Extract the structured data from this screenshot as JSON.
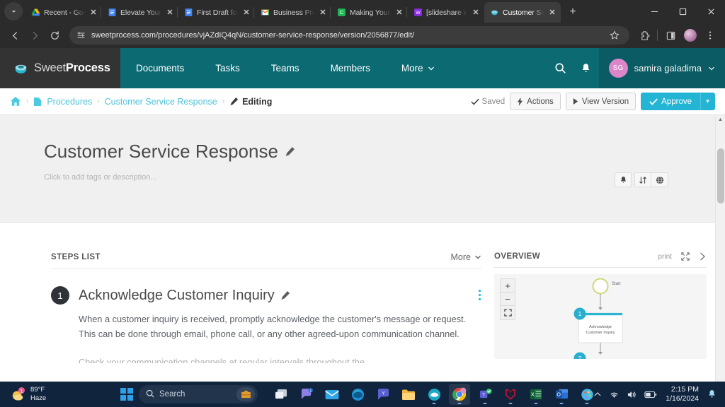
{
  "browser": {
    "tabs": [
      {
        "title": "Recent - Goo",
        "favicon": "google-drive-icon",
        "active": false
      },
      {
        "title": "Elevate Your H",
        "favicon": "google-docs-icon",
        "active": false
      },
      {
        "title": "First Draft for",
        "favicon": "google-docs-icon",
        "active": false
      },
      {
        "title": "Business Proc",
        "favicon": "gmail-icon",
        "active": false
      },
      {
        "title": "Making Your B",
        "favicon": "camtasia-icon",
        "active": false
      },
      {
        "title": "[slideshare id",
        "favicon": "wordpress-icon",
        "active": false
      },
      {
        "title": "Customer Ser",
        "favicon": "sweetprocess-icon",
        "active": true
      }
    ],
    "new_tab_label": "+",
    "window_minimize": "–",
    "window_maximize": "☐",
    "window_close": "✕",
    "url": "sweetprocess.com/procedures/vjAZdIQ4qN/customer-service-response/version/2056877/edit/",
    "back_label": "←",
    "forward_label": "→",
    "reload_label": "↻"
  },
  "topnav": {
    "logo_light": "Sweet",
    "logo_bold": "Process",
    "items": [
      {
        "label": "Documents",
        "has_caret": false
      },
      {
        "label": "Tasks",
        "has_caret": false
      },
      {
        "label": "Teams",
        "has_caret": false
      },
      {
        "label": "Members",
        "has_caret": false
      },
      {
        "label": "More",
        "has_caret": true
      }
    ],
    "user": {
      "initials": "SG",
      "name": "samira galadima"
    }
  },
  "breadcrumb": {
    "home": "home-icon",
    "items": [
      {
        "label": "Procedures",
        "type": "link"
      },
      {
        "label": "Customer Service Response",
        "type": "link"
      },
      {
        "label": "Editing",
        "type": "current"
      }
    ],
    "separator": "›"
  },
  "actions": {
    "saved_label": "Saved",
    "actions_label": "Actions",
    "view_version_label": "View Version",
    "approve_label": "Approve",
    "approve_caret": "▾"
  },
  "document": {
    "title": "Customer Service Response",
    "title_edit_icon": "pencil-icon",
    "subtitle_placeholder": "Click to add tags or description...",
    "head_icons": [
      "bell-icon",
      "sort-icon",
      "globe-icon"
    ]
  },
  "steps_panel": {
    "heading": "STEPS LIST",
    "more_label": "More",
    "more_caret": "▾",
    "steps": [
      {
        "number": "1",
        "title": "Acknowledge Customer Inquiry",
        "edit_icon": "pencil-icon",
        "menu_icon": "kebab-menu-icon",
        "body": "When a customer inquiry is received, promptly acknowledge the customer's message or request. This can be done through email, phone call, or any other agreed-upon communication channel.",
        "body_cut": "Check your communication channels at regular intervals throughout the"
      }
    ]
  },
  "overview_panel": {
    "heading": "OVERVIEW",
    "print_label": "print",
    "expand_icon": "expand-icon",
    "collapse_icon": "chevron-right-icon",
    "zoom_in": "+",
    "zoom_out": "−",
    "zoom_fit": "fit-screen-icon",
    "flowchart": {
      "start_label": "Start",
      "nodes": [
        {
          "number": "1",
          "label_line1": "Acknowledge",
          "label_line2": "Customer Inquiry"
        },
        {
          "number": "2",
          "label_line1": "",
          "label_line2": ""
        }
      ]
    }
  },
  "taskbar": {
    "weather": {
      "temp": "89°F",
      "condition": "Haze",
      "badge": "1"
    },
    "start_label": "windows-start-icon",
    "search_placeholder": "Search",
    "apps": [
      "task-view-icon",
      "teams-chat-icon",
      "mail-icon",
      "edge-icon",
      "yammer-icon",
      "file-explorer-icon",
      "sweetprocess-icon",
      "chrome-icon",
      "teams-icon",
      "mcafee-icon",
      "excel-icon",
      "outlook-icon",
      "paint-icon"
    ],
    "tray": [
      "chevron-up-icon",
      "wifi-icon",
      "volume-icon",
      "battery-icon"
    ],
    "clock_time": "2:15 PM",
    "clock_date": "1/16/2024",
    "notification_icon": "bell-icon"
  },
  "colors": {
    "brand_teal": "#0c6a73",
    "accent_cyan": "#23b5d3",
    "link_cyan": "#4fc3d9",
    "avatar_pink": "#dc85c8",
    "taskbar": "#10243d"
  }
}
